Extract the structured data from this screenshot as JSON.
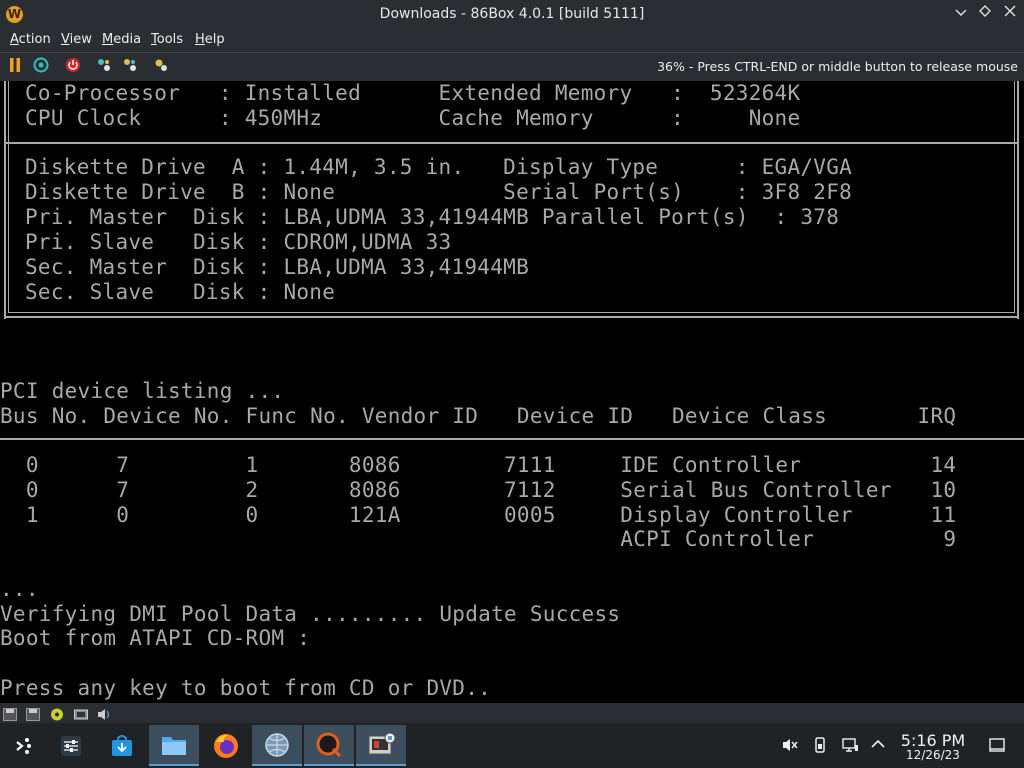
{
  "window": {
    "title": "Downloads - 86Box 4.0.1 [build 5111]",
    "app_icon": "W",
    "controls": [
      "minimize",
      "maximize",
      "close"
    ]
  },
  "menu": {
    "items": [
      {
        "first": "A",
        "rest": "ction"
      },
      {
        "first": "V",
        "rest": "iew"
      },
      {
        "first": "M",
        "rest": "edia"
      },
      {
        "first": "T",
        "rest": "ools"
      },
      {
        "first": "H",
        "rest": "elp"
      }
    ]
  },
  "toolbar": {
    "icons": [
      "pause-icon",
      "ctrl-alt-del-icon",
      "power-icon",
      "settings-icon",
      "hard-reset-icon",
      "screenshot-icon"
    ],
    "mouse_status": "36% - Press CTRL-END or middle button to release mouse"
  },
  "bios": {
    "lines_top": [
      "Co-Processor   : Installed      Extended Memory   :  523264K",
      "CPU Clock      : 450MHz         Cache Memory      :     None"
    ],
    "lines_box": [
      "Diskette Drive  A : 1.44M, 3.5 in.   Display Type      : EGA/VGA",
      "Diskette Drive  B : None             Serial Port(s)    : 3F8 2F8",
      "Pri. Master  Disk : LBA,UDMA 33,41944MB Parallel Port(s)  : 378",
      "Pri. Slave   Disk : CDROM,UDMA 33",
      "Sec. Master  Disk : LBA,UDMA 33,41944MB",
      "Sec. Slave   Disk : None"
    ],
    "pci_title": "PCI device listing ...",
    "pci_header": "Bus No. Device No. Func No. Vendor ID   Device ID   Device Class       IRQ",
    "pci_rows": [
      "  0      7         1       8086        7111     IDE Controller          14",
      "  0      7         2       8086        7112     Serial Bus Controller   10",
      "  1      0         0       121A        0005     Display Controller      11",
      "                                                ACPI Controller          9"
    ],
    "dots": "...",
    "dmi": "Verifying DMI Pool Data ......... Update Success",
    "boot": "Boot from ATAPI CD-ROM :",
    "press": "Press any key to boot from CD or DVD.."
  },
  "statusbar": {
    "icons": [
      "floppy-a-icon",
      "floppy-b-icon",
      "cdrom-icon",
      "network-icon",
      "sound-icon"
    ]
  },
  "taskbar": {
    "apps": [
      "app-launcher-icon",
      "mixer-settings-icon",
      "discover-store-icon",
      "dolphin-files-icon",
      "firefox-icon",
      "network-globe-icon",
      "quassel-icon",
      "86box-icon"
    ],
    "tray": [
      "volume-muted-icon",
      "usb-device-icon",
      "network-wired-icon",
      "tray-expand-icon"
    ],
    "time": "5:16 PM",
    "date": "12/26/23"
  },
  "colors": {
    "panel": "#2a2e32",
    "text_dos": "#a8a8a8",
    "taskbar": "#1f2326",
    "accent": "#5b9bd5"
  }
}
